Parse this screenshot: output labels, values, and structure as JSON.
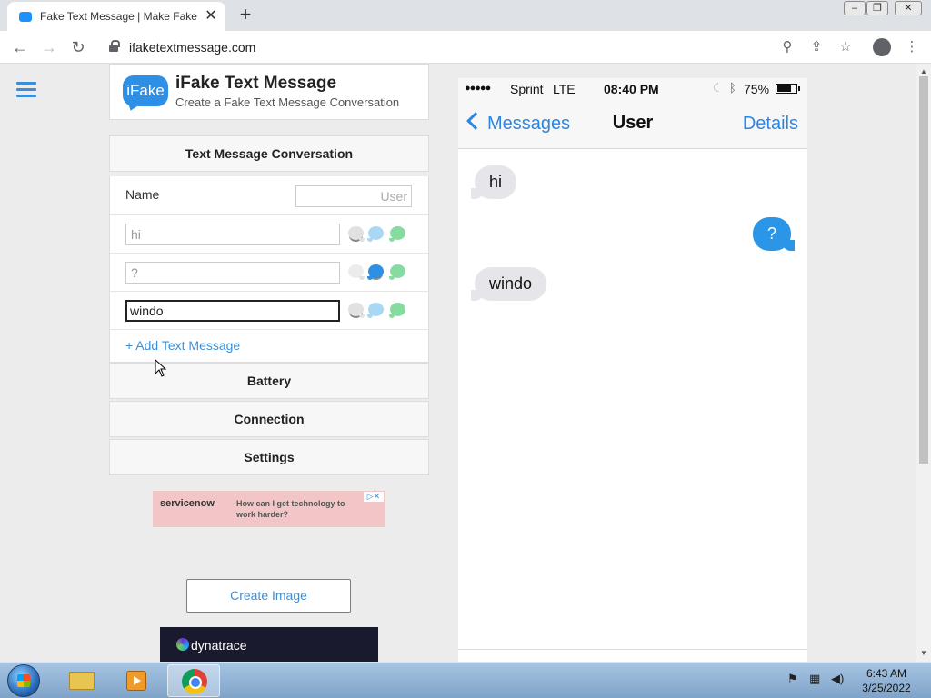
{
  "browser": {
    "tab_title": "Fake Text Message | Make Fake Te",
    "tab_close": "✕",
    "new_tab": "+",
    "url": "ifaketextmessage.com",
    "window_buttons": [
      "‒",
      "❐",
      "✕"
    ]
  },
  "site": {
    "logo_badge": "iFake",
    "title": "iFake Text Message",
    "subtitle": "Create a Fake Text Message Conversation"
  },
  "form": {
    "section_title": "Text Message Conversation",
    "name_label": "Name",
    "name_placeholder": "User",
    "messages": [
      {
        "text": "hi",
        "placeholder": "hi",
        "sender": "them"
      },
      {
        "text": "?",
        "placeholder": "?",
        "sender": "me"
      },
      {
        "text": "windo",
        "placeholder": "",
        "sender": "them"
      }
    ],
    "add_message": "+ Add Text Message",
    "sections": [
      "Battery",
      "Connection",
      "Settings"
    ]
  },
  "ad": {
    "brand": "servicenow",
    "text": "How can I get technology to work harder?",
    "badge": "▷✕"
  },
  "create_button": "Create Image",
  "bottom_ad": {
    "brand": "dynatrace"
  },
  "phone": {
    "signal": "●●●●●",
    "carrier": "Sprint",
    "network": "LTE",
    "time": "08:40 PM",
    "battery_pct": "75%",
    "battery_level": 0.75,
    "back_label": "Messages",
    "contact": "User",
    "details": "Details",
    "conversation": [
      {
        "text": "hi",
        "side": "in"
      },
      {
        "text": "?",
        "side": "out"
      },
      {
        "text": "windo",
        "side": "in"
      }
    ]
  },
  "taskbar": {
    "time": "6:43 AM",
    "date": "3/25/2022"
  }
}
